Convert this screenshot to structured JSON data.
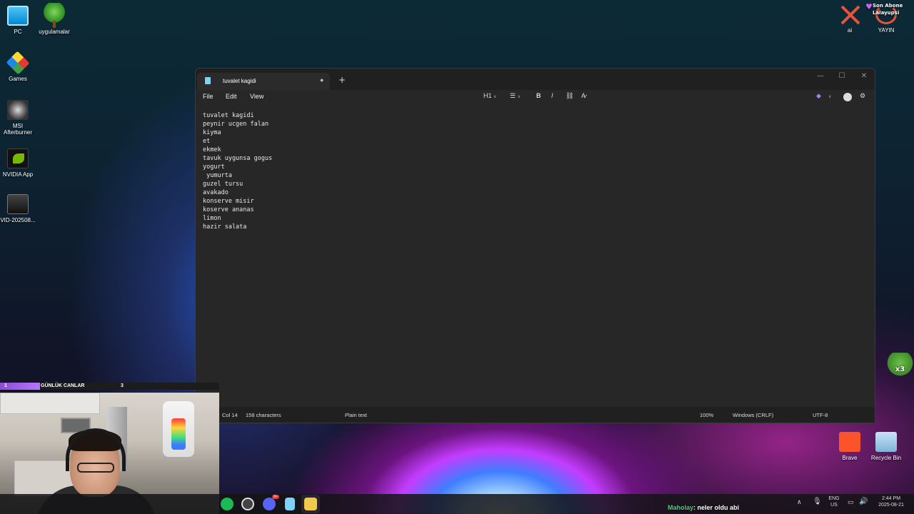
{
  "desktop": {
    "icons": {
      "pc": "PC",
      "uygulamalar": "uygulamalar",
      "games": "Games",
      "msi": "MSI Afterburner",
      "nvidia": "NVIDIA App",
      "vid": "VID-202508...",
      "ai": "ai",
      "yayin": "YAYIN",
      "brave": "Brave",
      "recycle": "Recycle Bin"
    }
  },
  "overlay": {
    "abone_title": "Son Abone",
    "abone_name": "Lalayupsi",
    "canlar_left": "1",
    "canlar_label": "GÜNLÜK CANLAR",
    "canlar_right": "3",
    "frog_badge": "x3",
    "chat_user": "Maholay",
    "chat_message": ": neler oldu abi"
  },
  "notepad": {
    "tab_title": "tuvalet kagidi",
    "menu": {
      "file": "File",
      "edit": "Edit",
      "view": "View"
    },
    "toolbar": {
      "heading": "H1"
    },
    "lines": [
      "tuvalet kagidi",
      "peynir ucgen falan",
      "kiyma",
      "et",
      "ekmek",
      "tavuk uygunsa gogus",
      "yogurt",
      " yumurta",
      "guzel tursu",
      "avakado",
      "konserve misir",
      "koserve ananas",
      "limon",
      "hazir salata"
    ],
    "status": {
      "position": "Col 14",
      "chars": "158 characters",
      "format": "Plain text",
      "zoom": "100%",
      "line_ending": "Windows (CRLF)",
      "encoding": "UTF-8"
    }
  },
  "taskbar": {
    "discord_badge": "9+",
    "lang": "ENG",
    "region": "US",
    "time": "2:44 PM",
    "date": "2025-08-21"
  }
}
